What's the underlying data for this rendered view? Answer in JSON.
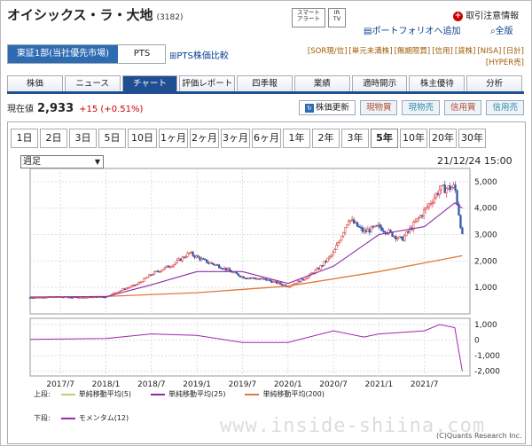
{
  "header": {
    "company": "オイシックス・ラ・大地",
    "code": "(3182)",
    "smart_alert": "スマート\nアラート",
    "ir_tv": "IR\nTV",
    "portfolio": "ポートフォリオへ追加",
    "all_view": "全版",
    "order_notice": "取引注意情報"
  },
  "market": {
    "selected": "東証1部(当社優先市場)",
    "pts": "PTS",
    "compare": "PTS株価比較"
  },
  "badges": {
    "row1": [
      "[SOR現/信]",
      "[単元未満株]",
      "[無期限買]",
      "[信用]",
      "[貸株]",
      "[NISA]",
      "[日計]"
    ],
    "row2": "[HYPER売]"
  },
  "tabs": [
    "株価",
    "ニュース",
    "チャート",
    "評価レポート",
    "四季報",
    "業績",
    "適時開示",
    "株主優待",
    "分析"
  ],
  "price": {
    "label": "現在値",
    "value": "2,933",
    "change": "+15 (+0.51%)"
  },
  "actions": {
    "refresh": "株価更新",
    "buy": "現物買",
    "sell": "現物売",
    "margin_buy": "信用買",
    "margin_sell": "信用売"
  },
  "ranges": [
    "1日",
    "2日",
    "3日",
    "5日",
    "10日",
    "1ヶ月",
    "2ヶ月",
    "3ヶ月",
    "6ヶ月",
    "1年",
    "2年",
    "3年",
    "5年",
    "10年",
    "20年",
    "30年"
  ],
  "period_select": "週足",
  "as_of": "21/12/24 15:00",
  "legend": {
    "upper_label": "上段:",
    "lower_label": "下段:",
    "ma5": "単純移動平均(5)",
    "ma25": "単純移動平均(25)",
    "ma200": "単純移動平均(200)",
    "momentum": "モメンタム(12)"
  },
  "colors": {
    "ma5": "#c8c86a",
    "ma25": "#8e2aa8",
    "ma200": "#e07a3a",
    "momentum": "#9a2aa8",
    "up": "#d33",
    "down": "#35a"
  },
  "watermark": "www.inside-shiina.com",
  "copyright": "(C)Quants Research Inc.",
  "chart_data": {
    "type": "line",
    "x_ticks": [
      "2017/7",
      "2018/1",
      "2018/7",
      "2019/1",
      "2019/7",
      "2020/1",
      "2020/7",
      "2021/1",
      "2021/7"
    ],
    "price_axis": {
      "ticks": [
        "5,000",
        "4,000",
        "3,000",
        "2,000",
        "1,000"
      ],
      "ylim": [
        0,
        5500
      ]
    },
    "momentum_axis": {
      "ticks": [
        "1,000",
        "0",
        "-1,000",
        "-2,000"
      ],
      "ylim": [
        -2300,
        1400
      ]
    },
    "price_series": [
      {
        "date": "2017/3",
        "value": 620
      },
      {
        "date": "2017/7",
        "value": 640
      },
      {
        "date": "2017/10",
        "value": 620
      },
      {
        "date": "2018/1",
        "value": 650
      },
      {
        "date": "2018/3",
        "value": 900
      },
      {
        "date": "2018/5",
        "value": 1100
      },
      {
        "date": "2018/7",
        "value": 1500
      },
      {
        "date": "2018/10",
        "value": 1900
      },
      {
        "date": "2018/12",
        "value": 2300
      },
      {
        "date": "2019/2",
        "value": 2000
      },
      {
        "date": "2019/4",
        "value": 1800
      },
      {
        "date": "2019/7",
        "value": 1400
      },
      {
        "date": "2019/10",
        "value": 1300
      },
      {
        "date": "2020/1",
        "value": 1050
      },
      {
        "date": "2020/3",
        "value": 1300
      },
      {
        "date": "2020/5",
        "value": 1700
      },
      {
        "date": "2020/7",
        "value": 2300
      },
      {
        "date": "2020/9",
        "value": 3600
      },
      {
        "date": "2020/11",
        "value": 3100
      },
      {
        "date": "2021/1",
        "value": 3300
      },
      {
        "date": "2021/4",
        "value": 2800
      },
      {
        "date": "2021/7",
        "value": 3900
      },
      {
        "date": "2021/9",
        "value": 4700
      },
      {
        "date": "2021/11",
        "value": 4800
      },
      {
        "date": "2021/12",
        "value": 2933
      }
    ],
    "ma25_series": [
      {
        "date": "2017/3",
        "value": 640
      },
      {
        "date": "2018/1",
        "value": 650
      },
      {
        "date": "2018/7",
        "value": 1100
      },
      {
        "date": "2019/1",
        "value": 1600
      },
      {
        "date": "2019/7",
        "value": 1600
      },
      {
        "date": "2020/1",
        "value": 1150
      },
      {
        "date": "2020/7",
        "value": 1800
      },
      {
        "date": "2021/1",
        "value": 3000
      },
      {
        "date": "2021/7",
        "value": 3300
      },
      {
        "date": "2021/11",
        "value": 4200
      },
      {
        "date": "2021/12",
        "value": 4000
      }
    ],
    "ma200_series": [
      {
        "date": "2017/3",
        "value": 620
      },
      {
        "date": "2018/1",
        "value": 660
      },
      {
        "date": "2019/1",
        "value": 800
      },
      {
        "date": "2020/1",
        "value": 1050
      },
      {
        "date": "2021/1",
        "value": 1600
      },
      {
        "date": "2021/12",
        "value": 2200
      }
    ],
    "momentum_series": [
      {
        "date": "2017/3",
        "value": 50
      },
      {
        "date": "2018/1",
        "value": 100
      },
      {
        "date": "2018/7",
        "value": 400
      },
      {
        "date": "2019/1",
        "value": 300
      },
      {
        "date": "2019/7",
        "value": -150
      },
      {
        "date": "2020/1",
        "value": -150
      },
      {
        "date": "2020/7",
        "value": 600
      },
      {
        "date": "2020/11",
        "value": 200
      },
      {
        "date": "2021/1",
        "value": 400
      },
      {
        "date": "2021/7",
        "value": 600
      },
      {
        "date": "2021/9",
        "value": 1000
      },
      {
        "date": "2021/11",
        "value": 800
      },
      {
        "date": "2021/12",
        "value": -2000
      }
    ]
  }
}
